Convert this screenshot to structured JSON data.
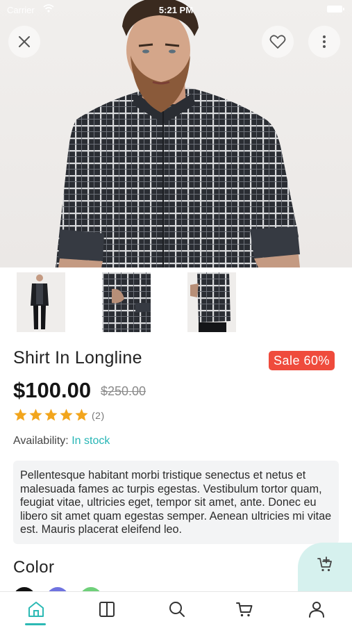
{
  "status_bar": {
    "carrier": "Carrier",
    "time": "5:21 PM"
  },
  "product": {
    "title": "Shirt In Longline",
    "sale_badge": "Sale 60%",
    "price": "$100.00",
    "old_price": "$250.00",
    "rating": 5,
    "rating_count": "(2)",
    "availability_label": "Availability:",
    "availability_value": "In stock",
    "description": "Pellentesque habitant morbi tristique senectus et netus et malesuada fames ac turpis egestas. Vestibulum tortor quam, feugiat vitae, ultricies eget, tempor sit amet, ante. Donec eu libero sit amet quam egestas semper. Aenean ultricies mi vitae est. Mauris placerat eleifend leo.",
    "color_heading": "Color",
    "colors": [
      "#111111",
      "#6f73e0",
      "#6fd07a"
    ]
  },
  "thumbnails": [
    "thumbnail-full-body",
    "thumbnail-back-detail",
    "thumbnail-side-view"
  ],
  "tabbar": {
    "items": [
      "home-icon",
      "catalog-icon",
      "search-icon",
      "cart-icon",
      "account-icon"
    ],
    "active": "home-icon",
    "accent": "#2bb9b4"
  },
  "colors": {
    "accent": "#2bb9b4",
    "sale": "#ef4b3c",
    "stock": "#26b5b5"
  }
}
